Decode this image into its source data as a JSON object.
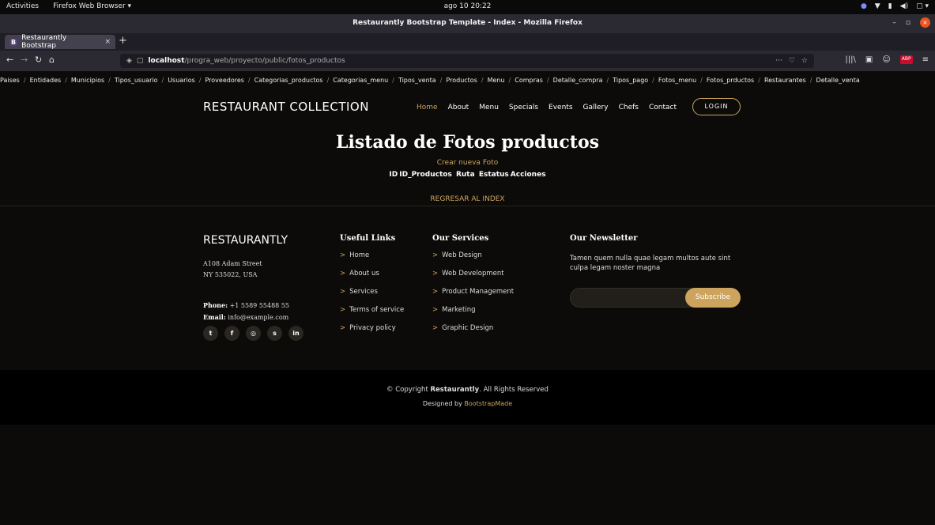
{
  "system": {
    "activities": "Activities",
    "app_menu": "Firefox Web Browser ▾",
    "clock": "ago 10  20:22",
    "tray": [
      "●",
      "▼",
      "▮",
      "◀)",
      "▢ ▾"
    ]
  },
  "window": {
    "title": "Restaurantly Bootstrap Template - Index - Mozilla Firefox",
    "minimize": "–",
    "maximize": "▫",
    "close": "×"
  },
  "tabs": [
    {
      "favicon": "B",
      "label": "Restaurantly Bootstrap",
      "close": "×"
    }
  ],
  "new_tab": "+",
  "nav": {
    "back": "←",
    "forward": "→",
    "reload": "↻",
    "home": "⌂",
    "url_host": "localhost",
    "url_path": "/progra_web/proyecto/public/fotos_productos",
    "page_actions": "···",
    "pocket": "♡",
    "star": "☆",
    "library": "|||\\",
    "sidebar": "▣",
    "account": "☺",
    "abp": "ABP",
    "menu": "≡"
  },
  "breadcrumb": [
    "Paises",
    "Entidades",
    "Municipios",
    "Tipos_usuario",
    "Usuarios",
    "Proveedores",
    "Categorias_productos",
    "Categorias_menu",
    "Tipos_venta",
    "Productos",
    "Menu",
    "Compras",
    "Detalle_compra",
    "Tipos_pago",
    "Fotos_menu",
    "Fotos_prductos",
    "Restaurantes",
    "Detalle_venta"
  ],
  "breadcrumb_sep": "/",
  "site": {
    "logo": "RESTAURANT COLLECTION",
    "menu": [
      "Home",
      "About",
      "Menu",
      "Specials",
      "Events",
      "Gallery",
      "Chefs",
      "Contact"
    ],
    "login": "LOGIN"
  },
  "main": {
    "title": "Listado de Fotos productos",
    "create_link": "Crear nueva Foto",
    "table_headers": [
      "ID",
      "ID_Productos",
      "Ruta",
      "Estatus",
      "Acciones"
    ],
    "back_link": "REGRESAR AL INDEX"
  },
  "footer": {
    "brand": "RESTAURANTLY",
    "address1": "A108 Adam Street",
    "address2": "NY 535022, USA",
    "phone_label": "Phone:",
    "phone": "+1 5589 55488 55",
    "email_label": "Email:",
    "email": "info@example.com",
    "socials": [
      "t",
      "f",
      "◎",
      "s",
      "in"
    ],
    "useful_title": "Useful Links",
    "useful_links": [
      "Home",
      "About us",
      "Services",
      "Terms of service",
      "Privacy policy"
    ],
    "services_title": "Our Services",
    "services_links": [
      "Web Design",
      "Web Development",
      "Product Management",
      "Marketing",
      "Graphic Design"
    ],
    "chevron": ">",
    "newsletter_title": "Our Newsletter",
    "newsletter_text": "Tamen quem nulla quae legam multos aute sint culpa legam noster magna",
    "newsletter_placeholder": "",
    "subscribe": "Subscribe",
    "copyright_prefix": "© Copyright",
    "copyright_brand": "Restaurantly",
    "copyright_suffix": ". All Rights Reserved",
    "designed_by": "Designed by",
    "designer": "BootstrapMade"
  }
}
